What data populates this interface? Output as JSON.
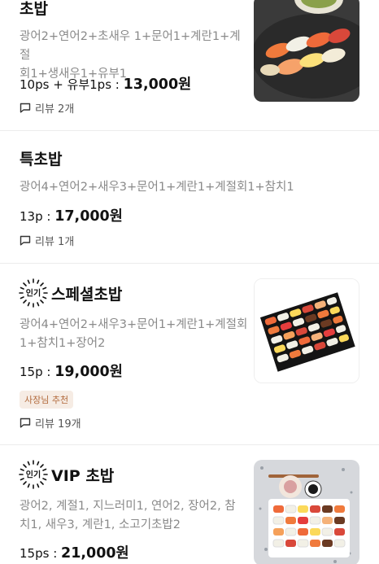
{
  "items": [
    {
      "name": "초밥",
      "description_lines": [
        "광어2+연어2+초새우 1+문어1+계란1+계절",
        "회1+생새우1+유부1"
      ],
      "quantity": "10ps + 유부1ps : ",
      "price": "13,000원",
      "review_label": "리뷰 2개",
      "has_image": true,
      "popular": false
    },
    {
      "name": "특초밥",
      "description_lines": [
        "광어4+연어2+새우3+문어1+계란1+계절회1+참치1"
      ],
      "quantity": "13p : ",
      "price": "17,000원",
      "review_label": "리뷰 1개",
      "has_image": false,
      "popular": false
    },
    {
      "name": "스페셜초밥",
      "popular_badge": "인기",
      "description_lines": [
        "광어4+연어2+새우3+문어1+계란1+계절회",
        "1+참치1+장어2"
      ],
      "quantity": "15p : ",
      "price": "19,000원",
      "owner_badge": "사장님 추천",
      "review_label": "리뷰 19개",
      "has_image": true,
      "popular": true
    },
    {
      "name": "VIP 초밥",
      "popular_badge": "인기",
      "description_lines": [
        "광어2, 계절1, 지느러미1, 연어2, 장어2, 참",
        "치1, 새우3, 계란1, 소고기초밥2"
      ],
      "quantity": "15ps : ",
      "price": "21,000원",
      "has_image": true,
      "popular": true
    }
  ],
  "icons": {
    "review": "speech-bubble-icon",
    "popular": "starburst-badge-icon"
  },
  "colors": {
    "owner_badge_text": "#b26a3c",
    "owner_badge_bg": "#f6ece4",
    "divider": "#ececec"
  }
}
